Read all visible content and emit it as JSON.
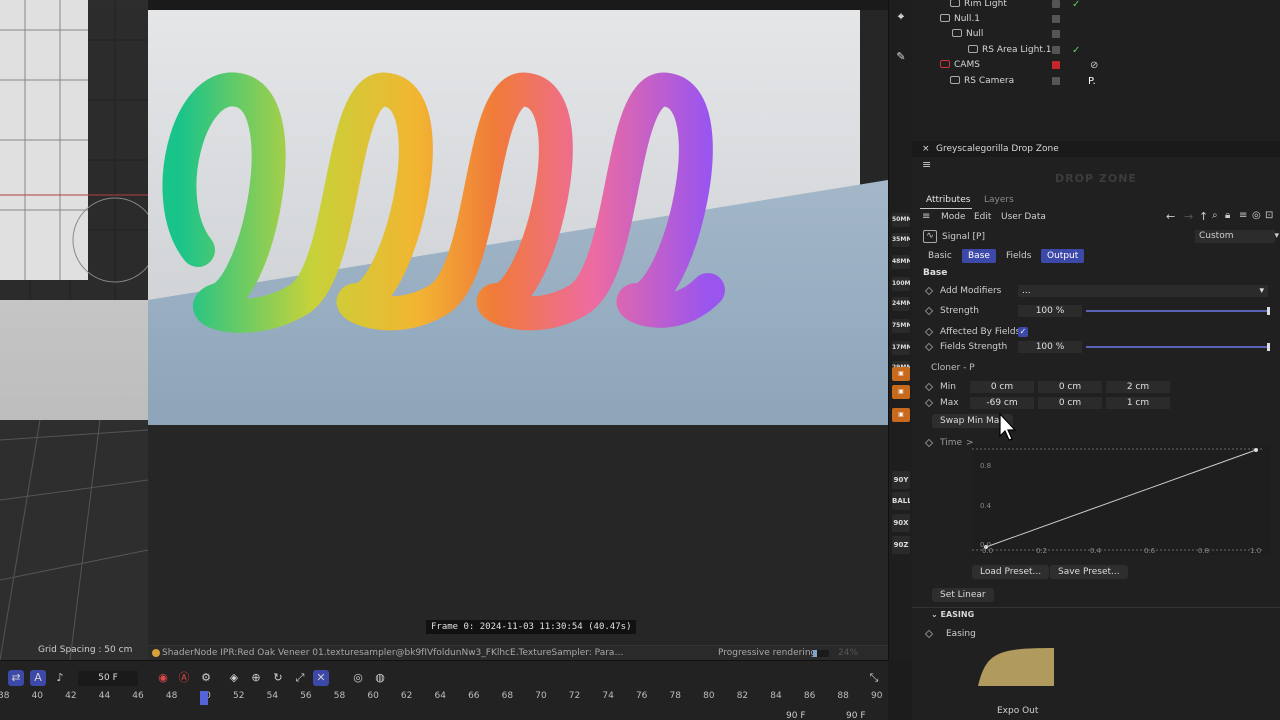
{
  "left_viewport": {
    "grid_spacing": "Grid Spacing : 50 cm"
  },
  "render_view": {
    "frame_label": "Frame 0:  2024-11-03  11:30:54  (40.47s)",
    "status_text": "ShaderNode IPR:Red Oak Veneer 01.texturesampler@bk9fIVfoldunNw3_FKlhcE.TextureSampler: Param t...",
    "progress_label": "Progressive rendering",
    "progress_value": 24,
    "progress_pct": "24%",
    "colors": [
      "#19c48a",
      "#f2b531",
      "#f07a3a",
      "#ee6ba0",
      "#9a55ef"
    ]
  },
  "timeline": {
    "current_frame": "50 F",
    "ticks": [
      "38",
      "40",
      "42",
      "44",
      "46",
      "48",
      "50",
      "52",
      "54",
      "56",
      "58",
      "60",
      "62",
      "64",
      "66",
      "68",
      "70",
      "72",
      "74",
      "76",
      "78",
      "80",
      "82",
      "84",
      "86",
      "88",
      "90"
    ],
    "end_frame_a": "90 F",
    "end_frame_b": "90 F"
  },
  "shortcut_strip": {
    "items": [
      "50MM",
      "35MM",
      "48MM",
      "100MM",
      "24MM",
      "75MM",
      "17MM",
      "29MM",
      "90Y",
      "BALL",
      "90X",
      "90Z"
    ]
  },
  "object_manager": {
    "rows": [
      {
        "name": "Rim Light",
        "check": "✓"
      },
      {
        "name": "Null.1",
        "check": ""
      },
      {
        "name": "Null",
        "check": ""
      },
      {
        "name": "RS Area Light.1",
        "check": "✓"
      },
      {
        "name": "CAMS",
        "check": "⊘"
      },
      {
        "name": "RS Camera",
        "check": "P."
      }
    ]
  },
  "dropzone": {
    "title": "Greyscalegorilla Drop Zone",
    "logo": "DROP ZONE"
  },
  "attributes": {
    "tabs": [
      "Attributes",
      "Layers"
    ],
    "menu": [
      "Mode",
      "Edit",
      "User Data"
    ],
    "object_name": "Signal [P]",
    "preset_dropdown": "Custom",
    "param_tabs": [
      "Basic",
      "Base",
      "Fields",
      "Output"
    ],
    "section_base": "Base",
    "add_modifiers_label": "Add Modifiers",
    "add_modifiers_value": "...",
    "strength_label": "Strength",
    "strength_value": "100 %",
    "strength_level": 1.0,
    "affected_label": "Affected By Fields",
    "affected_check": "✓",
    "fields_strength_label": "Fields Strength",
    "fields_strength_value": "100 %",
    "fields_strength_level": 1.0,
    "cloner_label": "Cloner - P",
    "min_label": "Min",
    "min_values": [
      "0 cm",
      "0 cm",
      "2 cm"
    ],
    "max_label": "Max",
    "max_values": [
      "-69 cm",
      "0 cm",
      "1 cm"
    ],
    "swap_button": "Swap Min Max",
    "time_label": "Time",
    "time_arrow": ">",
    "curve_y_labels": [
      "0.8",
      "0.4",
      "0.0"
    ],
    "curve_x_labels": [
      "0.0",
      "0.2",
      "0.4",
      "0.6",
      "0.8",
      "1.0"
    ],
    "load_preset": "Load Preset...",
    "save_preset": "Save Preset...",
    "set_linear": "Set Linear",
    "easing_section": "EASING",
    "easing_label": "Easing",
    "easing_value": "Expo Out"
  }
}
